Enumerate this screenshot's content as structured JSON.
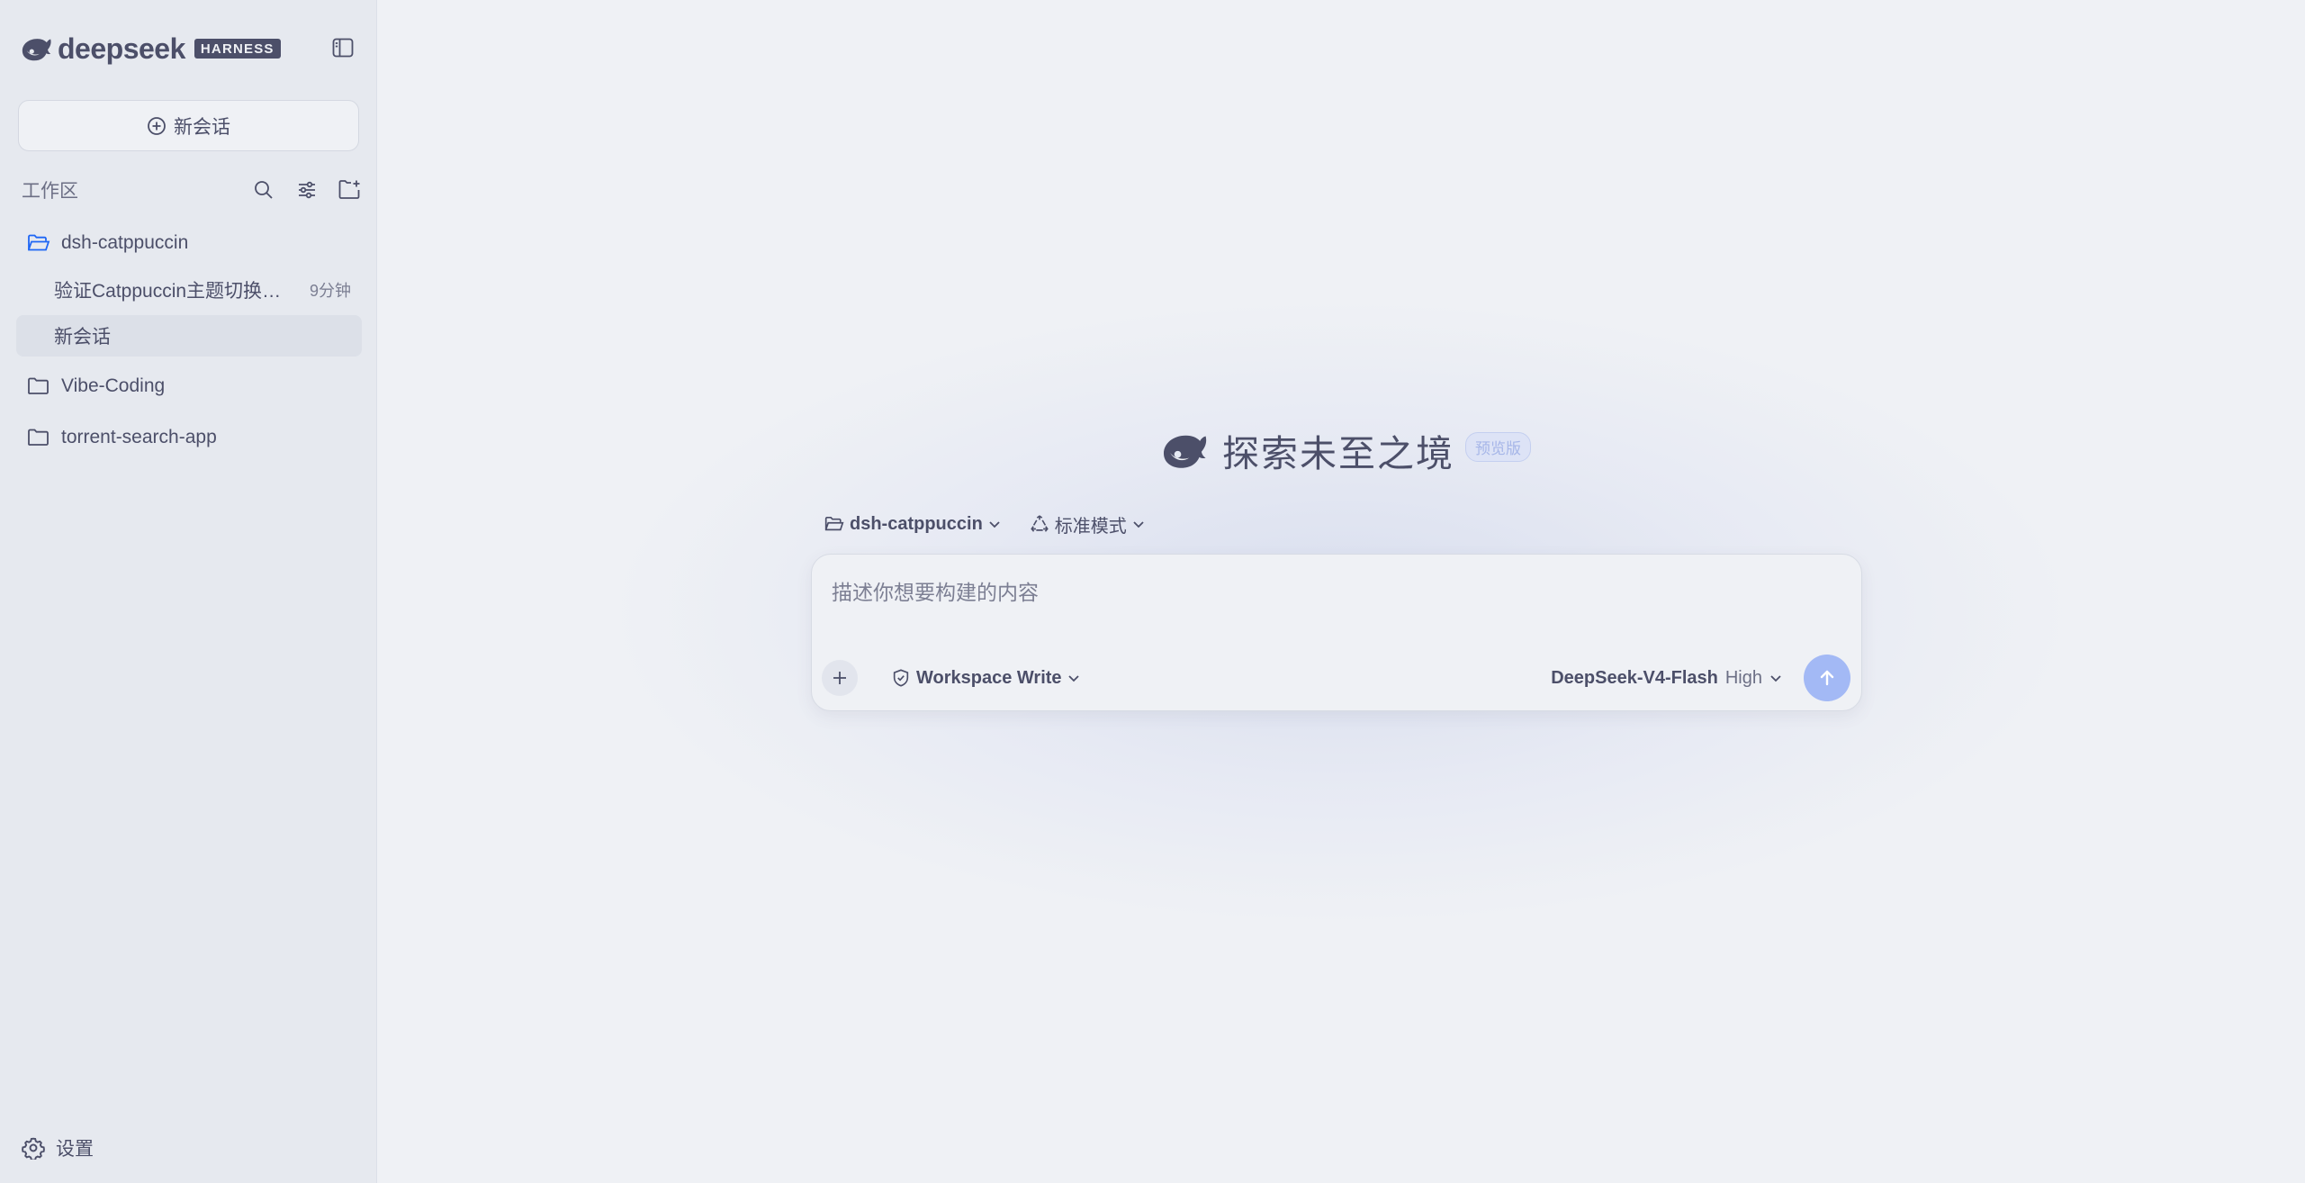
{
  "sidebar": {
    "brand": {
      "name": "deepseek",
      "badge": "HARNESS"
    },
    "new_chat_label": "新会话",
    "workspace": {
      "title": "工作区",
      "projects": [
        {
          "name": "dsh-catppuccin",
          "open": true,
          "conversations": [
            {
              "title": "验证Catppuccin主题切换与...",
              "time": "9分钟",
              "active": false
            },
            {
              "title": "新会话",
              "time": "",
              "active": true
            }
          ]
        },
        {
          "name": "Vibe-Coding",
          "open": false
        },
        {
          "name": "torrent-search-app",
          "open": false
        }
      ]
    },
    "settings_label": "设置"
  },
  "main": {
    "hero_title": "探索未至之境",
    "hero_badge": "预览版",
    "project_selector": "dsh-catppuccin",
    "mode_selector": "标准模式",
    "composer": {
      "placeholder": "描述你想要构建的内容",
      "value": "",
      "permission": "Workspace Write",
      "model": "DeepSeek-V4-Flash",
      "effort": "High"
    }
  },
  "colors": {
    "background": "#eff1f5",
    "sidebar": "#e6e9ef",
    "text": "#4c4f69",
    "accent_folder": "#1e66f5",
    "send_button": "#a3b9f5",
    "active_item": "#dce0e8"
  }
}
